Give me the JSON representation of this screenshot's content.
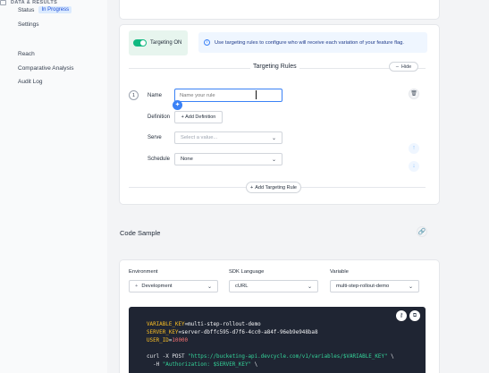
{
  "sidebar": {
    "status_label": "Status",
    "status_badge": "In Progress",
    "settings": "Settings",
    "section_title": "DATA & RESULTS",
    "reach": "Reach",
    "comparative": "Comparative Analysis",
    "audit": "Audit Log"
  },
  "targeting": {
    "toggle_label": "Targeting ON",
    "toggle_on": true,
    "info_text": "Use targeting rules to configure who will receive each variation of your feature flag.",
    "title": "Targeting Rules",
    "hide_label": "Hide",
    "rule_number": "1",
    "name_label": "Name",
    "name_placeholder": "Name your rule",
    "definition_label": "Definition",
    "add_definition": "+ Add Definition",
    "serve_label": "Serve",
    "serve_placeholder": "Select a value...",
    "schedule_label": "Schedule",
    "schedule_value": "None",
    "add_rule": "Add Targeting Rule"
  },
  "code_sample": {
    "title": "Code Sample",
    "environment_label": "Environment",
    "environment_value": "Development",
    "sdk_label": "SDK Language",
    "sdk_value": "cURL",
    "variable_label": "Variable",
    "variable_value": "multi-step-rollout-demo",
    "lines": {
      "l1_key": "VARIABLE_KEY",
      "l1_val": "multi-step-rollout-demo",
      "l2_key": "SERVER_KEY",
      "l2_val": "server-dbffc595-d7f6-4cc0-a84f-96eb9e948ba8",
      "l3_key": "USER_ID",
      "l3_val": "10000",
      "l5_cmd": "curl -X POST ",
      "l5_str": "\"https://bucketing-api.devcycle.com/v1/variables/$VARIABLE_KEY\"",
      "l5_tail": " \\",
      "l6_cmd": "  -H ",
      "l6_str": "\"Authorization: $SERVER_KEY\"",
      "l6_tail": " \\"
    }
  }
}
